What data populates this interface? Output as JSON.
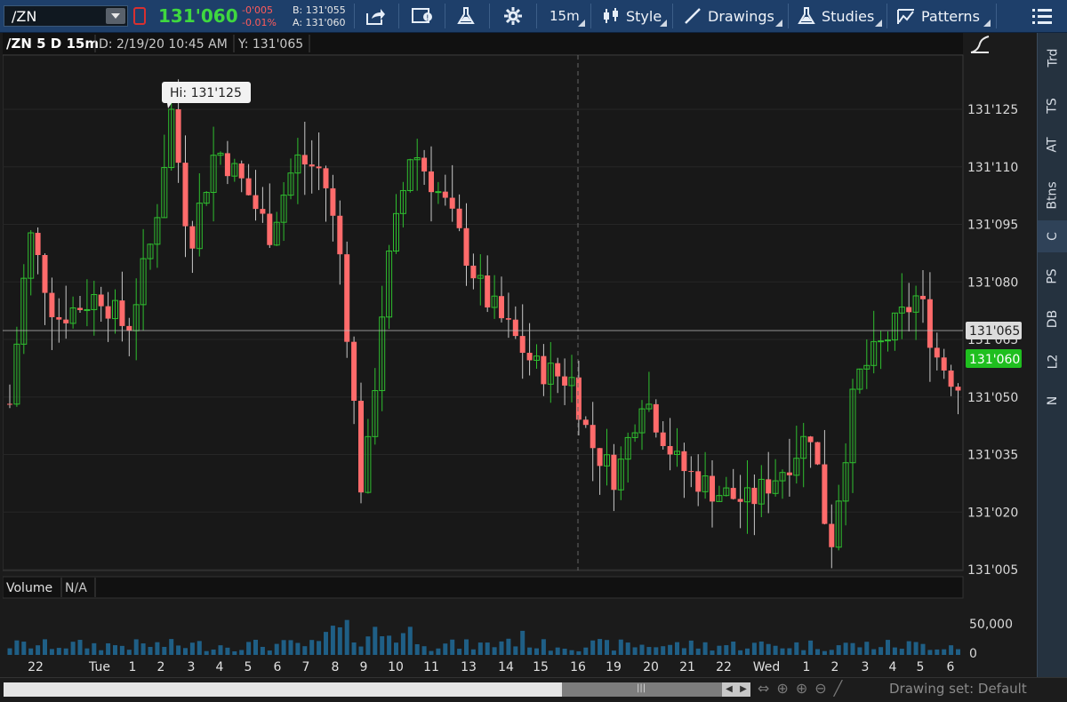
{
  "toolbar": {
    "symbol": "/ZN",
    "last": "131'060",
    "change": "-0'005",
    "change_pct": "-0.01%",
    "bid": "B: 131'055",
    "ask": "A: 131'060",
    "buttons": {
      "aggregation": "15m",
      "style": "Style",
      "drawings": "Drawings",
      "studies": "Studies",
      "patterns": "Patterns"
    }
  },
  "chart": {
    "title": "/ZN 5 D 15m",
    "date_readout": "D: 2/19/20 10:45 AM",
    "y_readout": "Y: 131'065",
    "hi_bubble": "Hi: 131'125",
    "crosshair_price": "131'065",
    "last_price_label": "131'060",
    "volume_title": "Volume",
    "volume_value": "N/A",
    "volume_tick": "50,000",
    "volume_zero": "0"
  },
  "chart_data": {
    "type": "candlestick",
    "instrument": "/ZN",
    "aggregation": "15m",
    "y_ticks": [
      "131'005",
      "131'020",
      "131'035",
      "131'050",
      "131'065",
      "131'080",
      "131'095",
      "131'110",
      "131'125"
    ],
    "y_tick_values": [
      131.15625,
      131.625,
      132.09375,
      132.5625,
      133.03125,
      133.5,
      133.96875,
      134.4375,
      134.90625
    ],
    "x_labels": [
      "22",
      "Tue",
      "1",
      "2",
      "3",
      "4",
      "5",
      "6",
      "7",
      "8",
      "9",
      "10",
      "11",
      "13",
      "14",
      "15",
      "16",
      "19",
      "20",
      "21",
      "22",
      "Wed",
      "1",
      "2",
      "3",
      "4",
      "5",
      "6"
    ],
    "hi": "131'125",
    "last": "131'060",
    "crosshair_y": "131'065",
    "up_color": "#2fbf2f",
    "down_color": "#ff6b6b",
    "volume_color": "#1f5f86"
  },
  "right_tabs": [
    "Trd",
    "TS",
    "AT",
    "Btns",
    "C",
    "PS",
    "DB",
    "L2",
    "N"
  ],
  "status": {
    "drawing_set": "Drawing set: Default"
  }
}
